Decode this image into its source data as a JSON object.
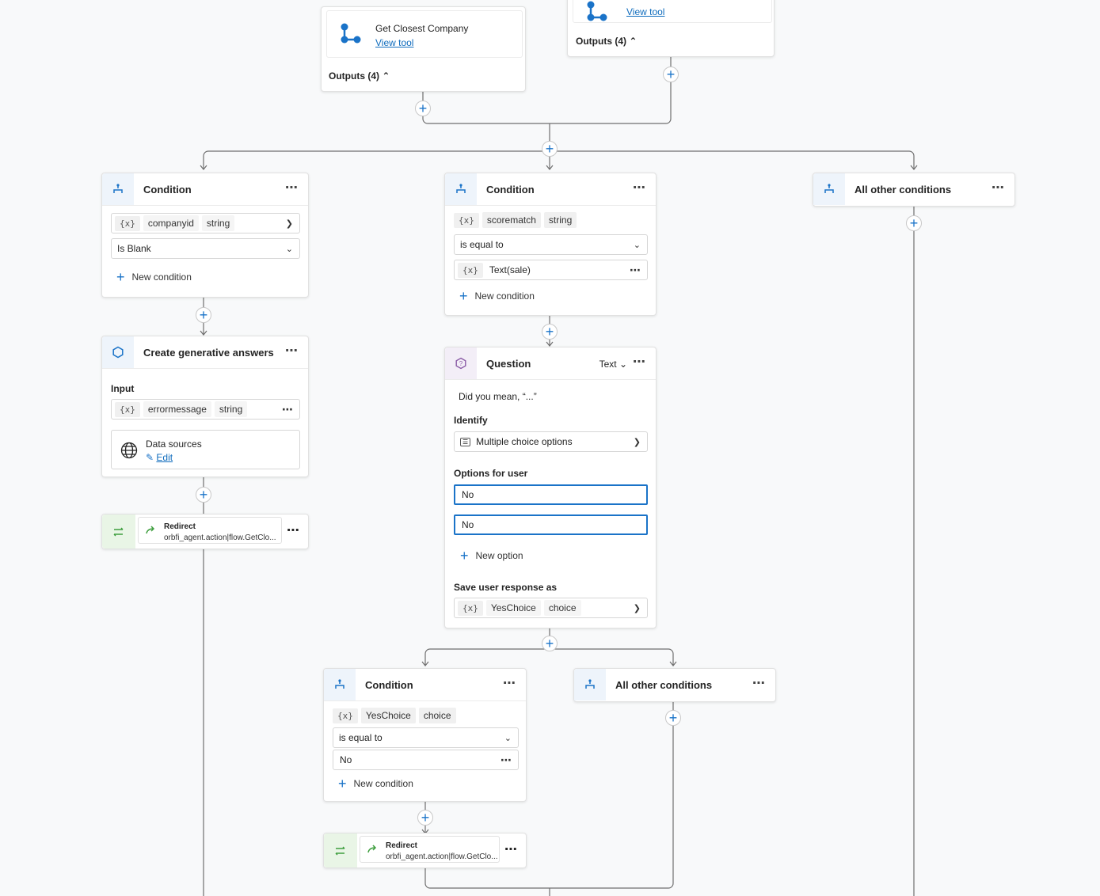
{
  "top_tool_left": {
    "title": "Get Closest Company",
    "link": "View tool",
    "outputs": "Outputs (4)"
  },
  "top_tool_right": {
    "link": "View tool",
    "outputs": "Outputs (4)"
  },
  "cond_left": {
    "title": "Condition",
    "var": "companyid",
    "type": "string",
    "operator": "Is Blank",
    "new_condition": "New condition"
  },
  "gen_answers": {
    "title": "Create generative answers",
    "input_label": "Input",
    "var": "errormessage",
    "type": "string",
    "ds_label": "Data sources",
    "ds_edit": "Edit"
  },
  "redirect_left": {
    "title": "Redirect",
    "target": "orbfi_agent.action|flow.GetClo..."
  },
  "cond_mid": {
    "title": "Condition",
    "var": "scorematch",
    "type": "string",
    "operator": "is equal to",
    "value": "Text(sale)",
    "new_condition": "New condition"
  },
  "question": {
    "title": "Question",
    "mode": "Text",
    "prompt": "Did you mean, “...”",
    "identify_label": "Identify",
    "identify_value": "Multiple choice options",
    "options_label": "Options for user",
    "options": [
      "No",
      "No"
    ],
    "new_option": "New option",
    "save_label": "Save user response as",
    "save_var": "YesChoice",
    "save_type": "choice"
  },
  "cond_right": {
    "title": "All other conditions"
  },
  "cond_bottom": {
    "title": "Condition",
    "var": "YesChoice",
    "type": "choice",
    "operator": "is equal to",
    "value": "No",
    "new_condition": "New condition"
  },
  "cond_bottom_other": {
    "title": "All other conditions"
  },
  "redirect_bottom": {
    "title": "Redirect",
    "target": "orbfi_agent.action|flow.GetClo..."
  },
  "icons": {
    "accent": "#1a73c8",
    "redirect_green": "#3f9f3f",
    "question_purple": "#8a5ba6"
  }
}
